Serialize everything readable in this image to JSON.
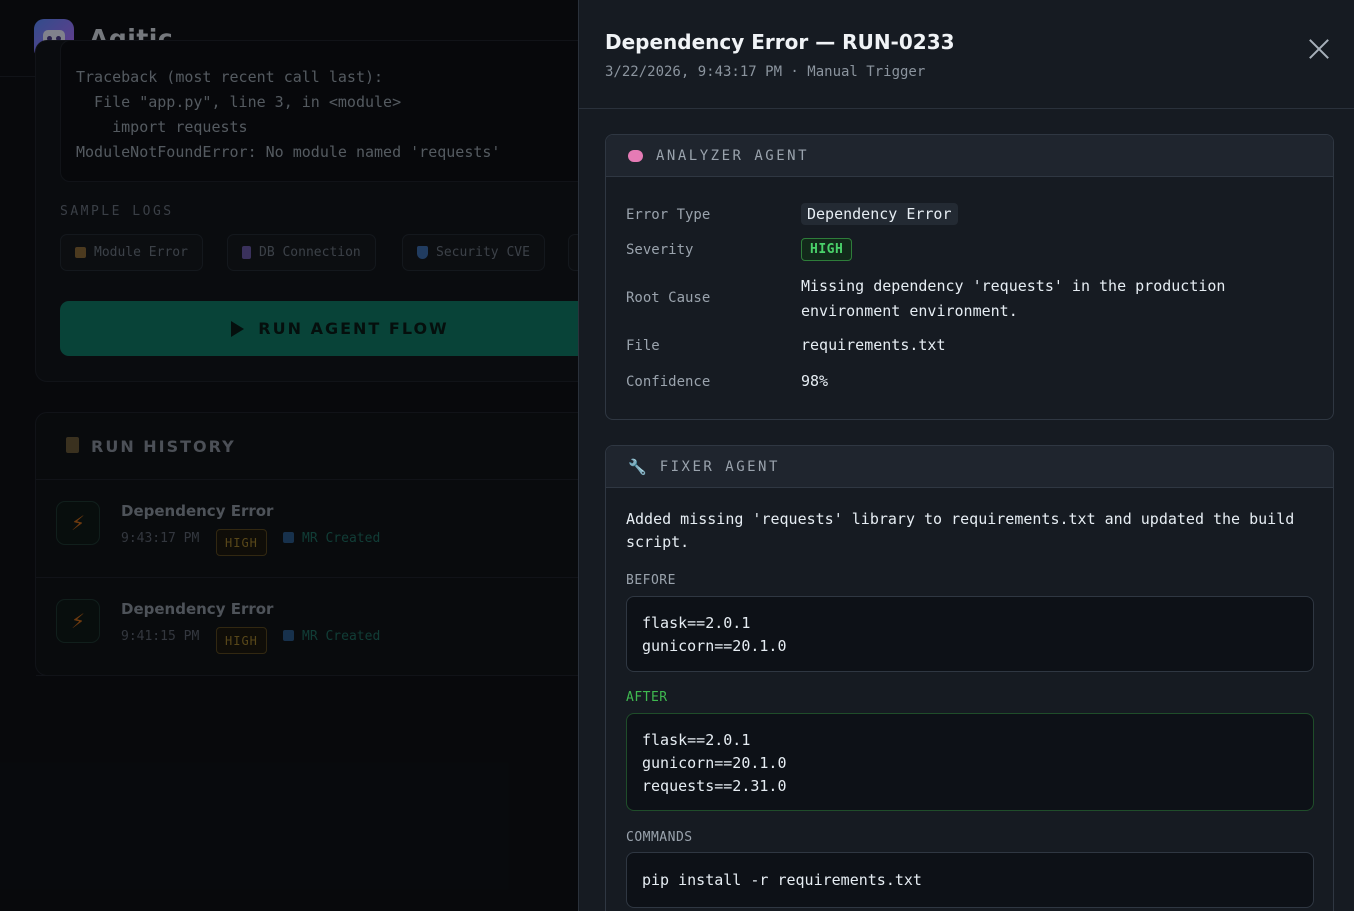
{
  "app": {
    "brand": "Agitic",
    "code_lines": [
      "Traceback (most recent call last):",
      "  File \"app.py\", line 3, in <module>",
      "    import requests",
      "ModuleNotFoundError: No module named 'requests'"
    ],
    "sample_logs_label": "SAMPLE LOGS",
    "sample_chips": [
      {
        "icon": "box-icon",
        "label": "Module Error"
      },
      {
        "icon": "database-icon",
        "label": "DB Connection"
      },
      {
        "icon": "shield-icon",
        "label": "Security CVE"
      }
    ],
    "run_button": "RUN AGENT FLOW",
    "history": {
      "title": "RUN HISTORY",
      "rows": [
        {
          "name": "Dependency Error",
          "time": "9:43:17 PM",
          "severity": "HIGH",
          "status": "MR Created"
        },
        {
          "name": "Dependency Error",
          "time": "9:41:15 PM",
          "severity": "HIGH",
          "status": "MR Created"
        }
      ]
    }
  },
  "drawer": {
    "title": "Dependency Error — RUN-0233",
    "subtitle": "3/22/2026, 9:43:17 PM · Manual Trigger",
    "analyzer": {
      "header": "ANALYZER AGENT",
      "error_type_key": "Error Type",
      "error_type": "Dependency Error",
      "severity_key": "Severity",
      "severity": "HIGH",
      "root_cause_key": "Root Cause",
      "root_cause": "Missing dependency 'requests' in the production environment environment.",
      "file_key": "File",
      "file": "requirements.txt",
      "confidence_key": "Confidence",
      "confidence": "98%"
    },
    "fixer": {
      "header": "FIXER AGENT",
      "description": "Added missing 'requests' library to requirements.txt and updated the build script.",
      "before_label": "BEFORE",
      "before": [
        "flask==2.0.1",
        "gunicorn==20.1.0"
      ],
      "after_label": "AFTER",
      "after": [
        "flask==2.0.1",
        "gunicorn==20.1.0",
        "requests==2.31.0"
      ],
      "commands_label": "COMMANDS",
      "commands": [
        "pip install -r requirements.txt"
      ]
    }
  },
  "colors": {
    "accent_teal": "#0f7a67",
    "severity_green": "#3fb950",
    "drawer_bg": "#161b22"
  }
}
